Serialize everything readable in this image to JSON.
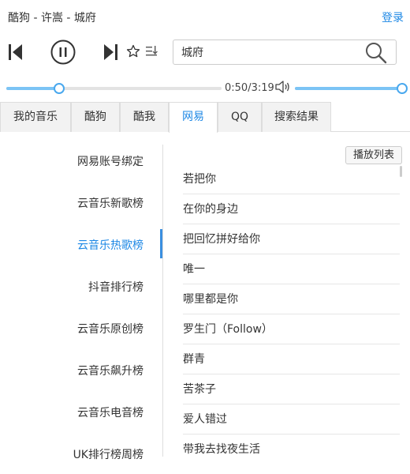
{
  "header": {
    "now_playing": "酷狗 - 许嵩 - 城府",
    "login": "登录"
  },
  "player": {
    "search_value": "城府",
    "time": "0:50/3:19",
    "progress_fraction": 0.245,
    "volume_fraction": 1.0
  },
  "tabs": [
    {
      "label": "我的音乐",
      "active": false
    },
    {
      "label": "酷狗",
      "active": false
    },
    {
      "label": "酷我",
      "active": false
    },
    {
      "label": "网易",
      "active": true
    },
    {
      "label": "QQ",
      "active": false
    },
    {
      "label": "搜索结果",
      "active": false
    }
  ],
  "sidebar": {
    "items": [
      {
        "label": "网易账号绑定",
        "active": false
      },
      {
        "label": "云音乐新歌榜",
        "active": false
      },
      {
        "label": "云音乐热歌榜",
        "active": true
      },
      {
        "label": "抖音排行榜",
        "active": false
      },
      {
        "label": "云音乐原创榜",
        "active": false
      },
      {
        "label": "云音乐飙升榜",
        "active": false
      },
      {
        "label": "云音乐电音榜",
        "active": false
      },
      {
        "label": "UK排行榜周榜",
        "active": false
      }
    ]
  },
  "songs": {
    "playlist_button": "播放列表",
    "items": [
      "若把你",
      "在你的身边",
      "把回忆拼好给你",
      "唯一",
      "哪里都是你",
      "罗生门（Follow）",
      "群青",
      "苦茶子",
      "爱人错过",
      "带我去找夜生活"
    ]
  },
  "icons": {
    "prev": "skip-previous-icon",
    "pause": "pause-circle-icon",
    "next": "skip-next-icon",
    "favorite": "star-outline-icon",
    "playlist": "playlist-icon",
    "search": "magnifier-icon",
    "volume": "volume-icon"
  },
  "colors": {
    "accent": "#1e88e5",
    "slider": "#7cc4f5",
    "knob_border": "#49a8ee"
  }
}
